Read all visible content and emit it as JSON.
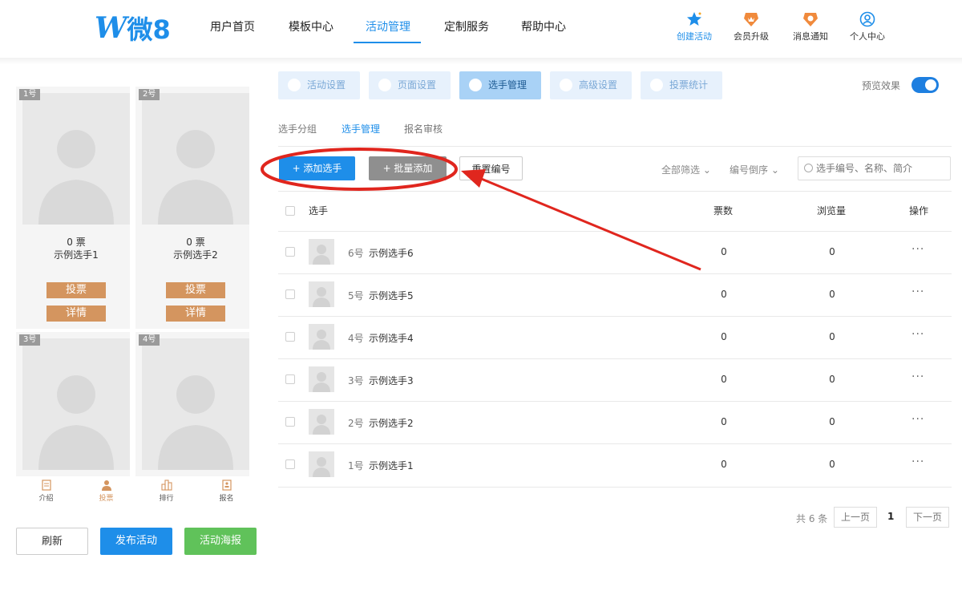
{
  "logo": {
    "mark": "W",
    "text": "微8"
  },
  "nav": {
    "links": [
      "用户首页",
      "模板中心",
      "活动管理",
      "定制服务",
      "帮助中心"
    ],
    "active": "活动管理",
    "right": [
      {
        "label": "创建活动",
        "icon": "star-icon"
      },
      {
        "label": "会员升级",
        "icon": "crown-icon"
      },
      {
        "label": "消息通知",
        "icon": "bell-icon"
      },
      {
        "label": "个人中心",
        "icon": "user-icon"
      }
    ]
  },
  "preview": {
    "cards": [
      {
        "badge": "1号",
        "votes": "0 票",
        "name": "示例选手1"
      },
      {
        "badge": "2号",
        "votes": "0 票",
        "name": "示例选手2"
      },
      {
        "badge": "3号"
      },
      {
        "badge": "4号"
      }
    ],
    "vote_label": "投票",
    "detail_label": "详情",
    "bottom_tabs": [
      "介绍",
      "投票",
      "排行",
      "报名"
    ],
    "buttons": {
      "refresh": "刷新",
      "publish": "发布活动",
      "poster": "活动海报"
    }
  },
  "main": {
    "tabs": [
      "活动设置",
      "页面设置",
      "选手管理",
      "高级设置",
      "投票统计"
    ],
    "active_tab": "选手管理",
    "preview_label": "预览效果",
    "preview_on": true,
    "subtabs": [
      "选手分组",
      "选手管理",
      "报名审核"
    ],
    "active_subtab": "选手管理",
    "actions": {
      "add": "+ 添加选手",
      "batch": "+ 批量添加",
      "renumber": "重置编号"
    },
    "filters": {
      "all": "全部筛选",
      "order": "编号倒序"
    },
    "search_placeholder": "选手编号、名称、简介",
    "columns": {
      "player": "选手",
      "votes": "票数",
      "views": "浏览量",
      "ops": "操作"
    },
    "rows": [
      {
        "num": "6号",
        "name": "示例选手6",
        "votes": "0",
        "views": "0"
      },
      {
        "num": "5号",
        "name": "示例选手5",
        "votes": "0",
        "views": "0"
      },
      {
        "num": "4号",
        "name": "示例选手4",
        "votes": "0",
        "views": "0"
      },
      {
        "num": "3号",
        "name": "示例选手3",
        "votes": "0",
        "views": "0"
      },
      {
        "num": "2号",
        "name": "示例选手2",
        "votes": "0",
        "views": "0"
      },
      {
        "num": "1号",
        "name": "示例选手1",
        "votes": "0",
        "views": "0"
      }
    ],
    "more": "···",
    "pager": {
      "total": "共 6 条",
      "prev": "上一页",
      "current": "1",
      "next": "下一页"
    }
  },
  "colors": {
    "primary": "#1e8ee9",
    "vote_button": "#d4955f",
    "poster": "#60c25a",
    "annotation": "#e0261e"
  }
}
